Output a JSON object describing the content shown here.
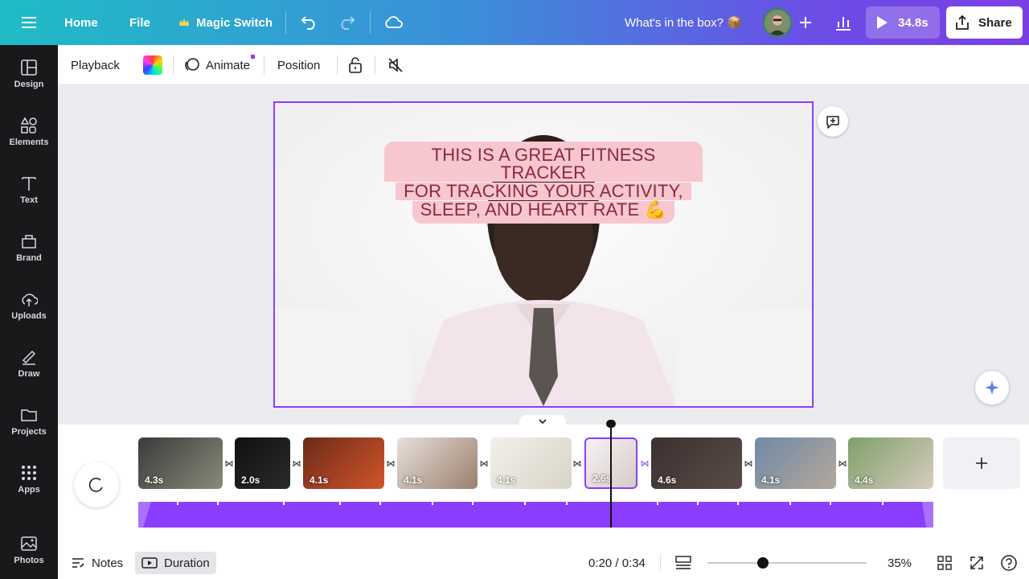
{
  "topbar": {
    "home": "Home",
    "file": "File",
    "magic_switch": "Magic Switch",
    "doc_title": "What's in the box? 📦",
    "play_duration": "34.8s",
    "share": "Share"
  },
  "sidebar": {
    "items": [
      {
        "label": "Design",
        "icon": "design-icon"
      },
      {
        "label": "Elements",
        "icon": "elements-icon"
      },
      {
        "label": "Text",
        "icon": "text-icon"
      },
      {
        "label": "Brand",
        "icon": "brand-icon"
      },
      {
        "label": "Uploads",
        "icon": "uploads-icon"
      },
      {
        "label": "Draw",
        "icon": "draw-icon"
      },
      {
        "label": "Projects",
        "icon": "projects-icon"
      },
      {
        "label": "Apps",
        "icon": "apps-icon"
      },
      {
        "label": "Photos",
        "icon": "photos-icon"
      }
    ]
  },
  "toolbar": {
    "playback": "Playback",
    "animate": "Animate",
    "position": "Position"
  },
  "canvas": {
    "caption_lines": [
      "THIS IS A GREAT FITNESS TRACKER",
      "FOR TRACKING YOUR ACTIVITY,",
      "SLEEP, AND HEART RATE 💪"
    ]
  },
  "timeline": {
    "clips": [
      {
        "duration": "4.3s",
        "colors": [
          "#3a3a3a",
          "#8a8a7a"
        ]
      },
      {
        "duration": "2.0s",
        "colors": [
          "#111111",
          "#2a2a2a"
        ]
      },
      {
        "duration": "4.1s",
        "colors": [
          "#6b2a1a",
          "#d2552a"
        ]
      },
      {
        "duration": "4.1s",
        "colors": [
          "#e8e0dc",
          "#9a7f6c"
        ]
      },
      {
        "duration": "4.1s",
        "colors": [
          "#f2f0ea",
          "#d8d4c8"
        ]
      },
      {
        "duration": "2.6s",
        "colors": [
          "#f5f3f3",
          "#d9c9c9"
        ]
      },
      {
        "duration": "4.6s",
        "colors": [
          "#3b3130",
          "#5a4b47"
        ]
      },
      {
        "duration": "4.1s",
        "colors": [
          "#6f8aa8",
          "#b5a79a"
        ]
      },
      {
        "duration": "4.4s",
        "colors": [
          "#7da06a",
          "#d8cbbf"
        ]
      }
    ]
  },
  "bottombar": {
    "notes": "Notes",
    "duration": "Duration",
    "time": "0:20 / 0:34",
    "zoom_percent": "35%",
    "zoom_level": 0.35
  }
}
